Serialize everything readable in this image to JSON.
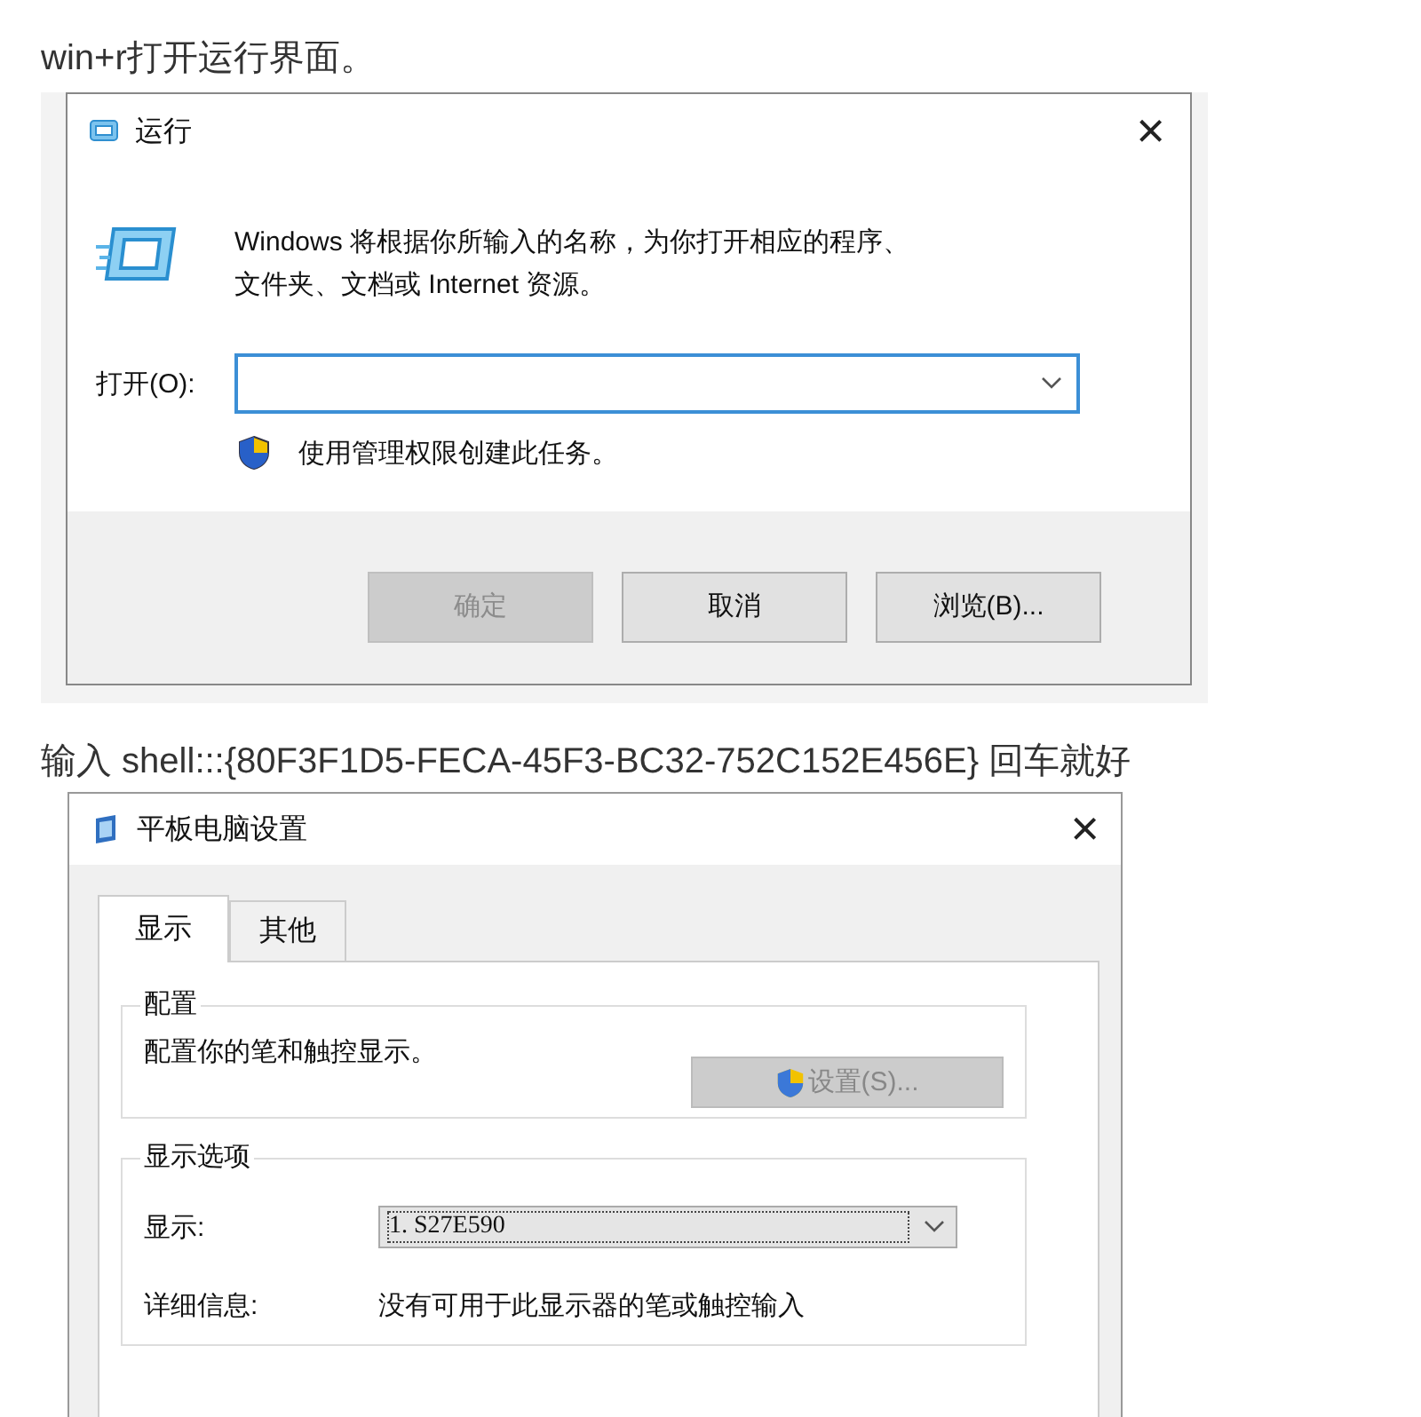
{
  "intro_1": "win+r打开运行界面。",
  "run_dialog": {
    "title": "运行",
    "close": "×",
    "description_lines": [
      "Windows 将根据你所输入的名称，为你打开相应的程序、",
      "文件夹、文档或 Internet 资源。"
    ],
    "open_label": "打开(O):",
    "open_field": {
      "focused": true
    },
    "admin_note": "使用管理权限创建此任务。",
    "buttons": [
      {
        "label": "确定",
        "disabled": true
      },
      {
        "label": "取消",
        "disabled": false
      },
      {
        "label": "浏览(B)...",
        "disabled": false
      }
    ]
  },
  "intro_2": "输入 shell:::{80F3F1D5-FECA-45F3-BC32-752C152E456E} 回车就好",
  "tablet_dialog": {
    "title": "平板电脑设置",
    "close": "×",
    "tabs": [
      {
        "label": "显示",
        "selected": true
      },
      {
        "label": "其他",
        "selected": false
      }
    ],
    "config_group": {
      "title": "配置",
      "description": "配置你的笔和触控显示。",
      "button": {
        "label": "设置(S)...",
        "disabled": true
      }
    },
    "display_group": {
      "title": "显示选项",
      "display_label": "显示:",
      "display_value": "1. S27E590",
      "details_label": "详细信息:",
      "details_value": "没有可用于此显示器的笔或触控输入"
    }
  }
}
